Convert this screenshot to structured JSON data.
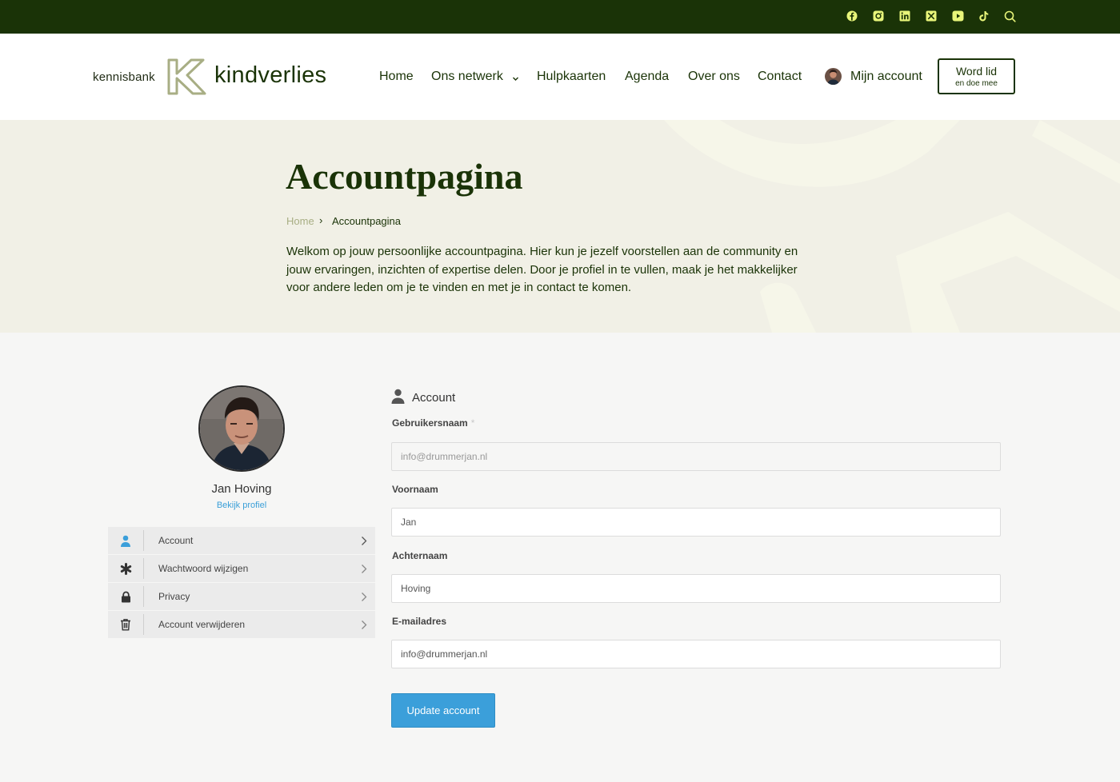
{
  "colors": {
    "topbar_bg": "#1a3307",
    "social_icon": "#e8f57a",
    "brand_dark": "#1a3307",
    "logo_k_outline": "#a8ae84",
    "hero_bg": "#f1f0e6",
    "button_blue": "#3b9fda",
    "profile_link": "#3a9fd8"
  },
  "topbar": {
    "social_icons": [
      "facebook-icon",
      "instagram-icon",
      "linkedin-icon",
      "x-icon",
      "youtube-icon",
      "tiktok-icon",
      "search-icon"
    ]
  },
  "header": {
    "logo_prefix": "kennisbank",
    "logo_word": "kindverlies",
    "nav": {
      "home": "Home",
      "network": "Ons netwerk",
      "helpcards": "Hulpkaarten",
      "agenda": "Agenda",
      "about": "Over ons",
      "contact": "Contact",
      "account": "Mijn account"
    },
    "cta": {
      "line1": "Word lid",
      "line2": "en doe mee"
    }
  },
  "hero": {
    "title": "Accountpagina",
    "breadcrumb": {
      "home": "Home",
      "separator": "›",
      "current": "Accountpagina"
    },
    "intro": "Welkom op jouw persoonlijke accountpagina. Hier kun je jezelf voorstellen aan de community en jouw ervaringen, inzichten of expertise delen. Door je profiel in te vullen, maak je het makkelijker voor andere leden om je te vinden en met je in contact te komen."
  },
  "profile": {
    "name": "Jan Hoving",
    "view_link": "Bekijk profiel",
    "menu": [
      {
        "label": "Account",
        "icon": "user-icon"
      },
      {
        "label": "Wachtwoord wijzigen",
        "icon": "asterisk-icon"
      },
      {
        "label": "Privacy",
        "icon": "lock-icon"
      },
      {
        "label": "Account verwijderen",
        "icon": "trash-icon"
      }
    ]
  },
  "form": {
    "heading": "Account",
    "username": {
      "label": "Gebruikersnaam",
      "required_mark": "*",
      "value": "info@drummerjan.nl"
    },
    "firstname": {
      "label": "Voornaam",
      "value": "Jan"
    },
    "lastname": {
      "label": "Achternaam",
      "value": "Hoving"
    },
    "email": {
      "label": "E-mailadres",
      "value": "info@drummerjan.nl"
    },
    "submit": "Update account"
  }
}
